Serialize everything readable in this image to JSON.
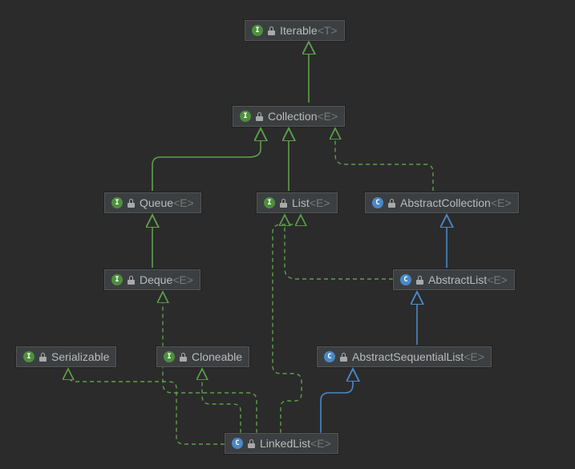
{
  "nodes": {
    "iterable": {
      "kind": "interface",
      "name": "Iterable",
      "generic": "<T>"
    },
    "collection": {
      "kind": "interface",
      "name": "Collection",
      "generic": "<E>"
    },
    "queue": {
      "kind": "interface",
      "name": "Queue",
      "generic": "<E>"
    },
    "list": {
      "kind": "interface",
      "name": "List",
      "generic": "<E>"
    },
    "abscoll": {
      "kind": "class",
      "name": "AbstractCollection",
      "generic": "<E>"
    },
    "deque": {
      "kind": "interface",
      "name": "Deque",
      "generic": "<E>"
    },
    "abslist": {
      "kind": "class",
      "name": "AbstractList",
      "generic": "<E>"
    },
    "serializable": {
      "kind": "interface",
      "name": "Serializable",
      "generic": ""
    },
    "cloneable": {
      "kind": "interface",
      "name": "Cloneable",
      "generic": ""
    },
    "absseqlist": {
      "kind": "class",
      "name": "AbstractSequentialList",
      "generic": "<E>"
    },
    "linkedlist": {
      "kind": "class",
      "name": "LinkedList",
      "generic": "<E>"
    }
  },
  "iconLetters": {
    "interface": "I",
    "class": "C"
  },
  "chart_data": {
    "type": "diagram",
    "title": "Java class hierarchy for LinkedList",
    "stereotypes": {
      "interface": "green circled I",
      "class": "blue circled C (concrete) / circled C badge"
    },
    "edges": [
      {
        "from": "Collection",
        "to": "Iterable",
        "style": "extends-interface (solid green, hollow triangle)"
      },
      {
        "from": "Queue",
        "to": "Collection",
        "style": "extends-interface"
      },
      {
        "from": "List",
        "to": "Collection",
        "style": "extends-interface"
      },
      {
        "from": "AbstractCollection",
        "to": "Collection",
        "style": "implements (dashed green, hollow triangle)"
      },
      {
        "from": "Deque",
        "to": "Queue",
        "style": "extends-interface"
      },
      {
        "from": "AbstractList",
        "to": "AbstractCollection",
        "style": "extends-class (solid blue, hollow triangle)"
      },
      {
        "from": "AbstractList",
        "to": "List",
        "style": "implements"
      },
      {
        "from": "AbstractSequentialList",
        "to": "AbstractList",
        "style": "extends-class"
      },
      {
        "from": "LinkedList",
        "to": "AbstractSequentialList",
        "style": "extends-class"
      },
      {
        "from": "LinkedList",
        "to": "Deque",
        "style": "implements"
      },
      {
        "from": "LinkedList",
        "to": "List",
        "style": "implements"
      },
      {
        "from": "LinkedList",
        "to": "Cloneable",
        "style": "implements"
      },
      {
        "from": "LinkedList",
        "to": "Serializable",
        "style": "implements"
      }
    ]
  }
}
